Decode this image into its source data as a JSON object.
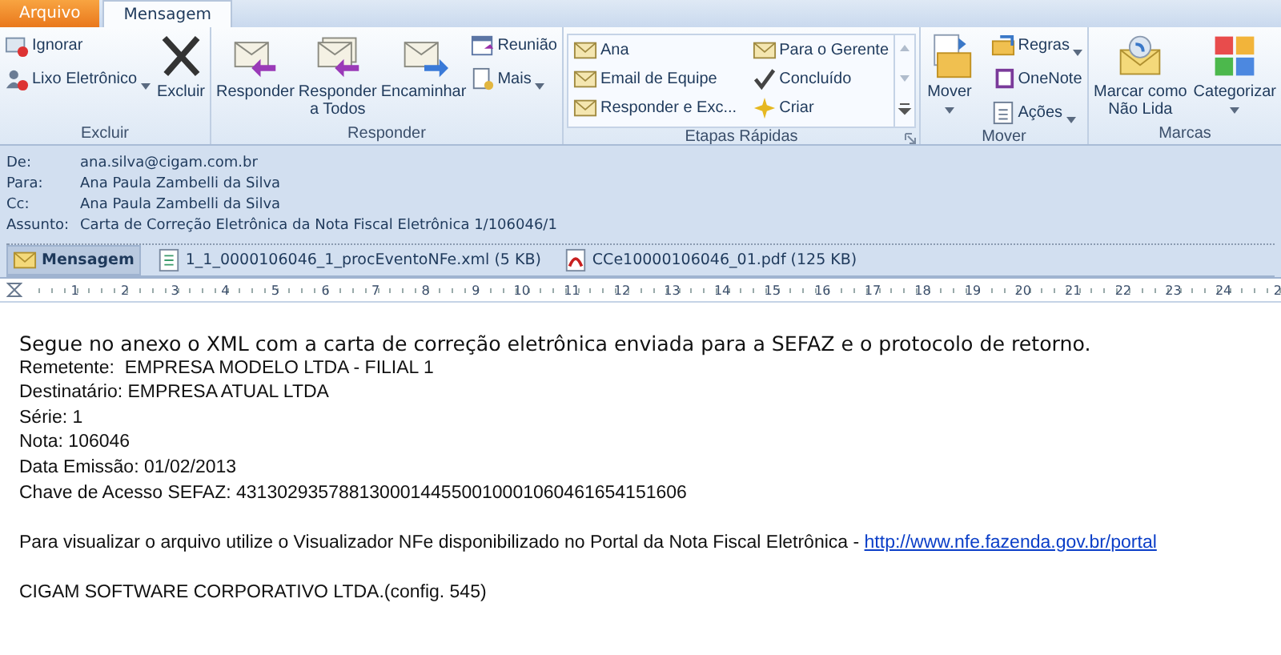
{
  "tabs": [
    {
      "label": "Arquivo",
      "kind": "file",
      "selected": false
    },
    {
      "label": "Mensagem",
      "kind": "tab",
      "selected": true
    }
  ],
  "ribbon": {
    "groups": [
      {
        "label": "Excluir",
        "kind": "buttons",
        "launcher": false,
        "buttons": [
          {
            "label": "Ignorar",
            "kind": "small",
            "dropdown": false
          },
          {
            "label": "Lixo Eletrônico",
            "kind": "small",
            "dropdown": true
          },
          {
            "label": "Excluir",
            "kind": "large",
            "dropdown": false
          }
        ]
      },
      {
        "label": "Responder",
        "kind": "buttons",
        "launcher": false,
        "buttons": [
          {
            "label": "Responder",
            "kind": "large",
            "dropdown": false
          },
          {
            "label": "Responder\na Todos",
            "kind": "large",
            "dropdown": false
          },
          {
            "label": "Encaminhar",
            "kind": "large",
            "dropdown": false
          },
          {
            "label": "Reunião",
            "kind": "small",
            "dropdown": false
          },
          {
            "label": "Mais",
            "kind": "small",
            "dropdown": true
          }
        ]
      },
      {
        "label": "Etapas Rápidas",
        "kind": "gallery",
        "launcher": true,
        "buttons": [
          {
            "label": "Ana"
          },
          {
            "label": "Email de Equipe"
          },
          {
            "label": "Responder e Exc..."
          },
          {
            "label": "Para o Gerente"
          },
          {
            "label": "Concluído"
          },
          {
            "label": "Criar"
          }
        ]
      },
      {
        "label": "Mover",
        "kind": "buttons",
        "launcher": false,
        "buttons": [
          {
            "label": "Mover",
            "kind": "large",
            "dropdown": true
          },
          {
            "label": "Regras",
            "kind": "small",
            "dropdown": true
          },
          {
            "label": "OneNote",
            "kind": "small",
            "dropdown": false
          },
          {
            "label": "Ações",
            "kind": "small",
            "dropdown": true
          }
        ]
      },
      {
        "label": "Marcas",
        "kind": "buttons",
        "launcher": false,
        "buttons": [
          {
            "label": "Marcar como\nNão Lida",
            "kind": "large",
            "dropdown": false
          },
          {
            "label": "Categorizar",
            "kind": "large",
            "dropdown": true
          }
        ]
      }
    ]
  },
  "header": [
    {
      "label": "De:",
      "value": "ana.silva@cigam.com.br"
    },
    {
      "label": "Para:",
      "value": "Ana Paula Zambelli da Silva"
    },
    {
      "label": "Cc:",
      "value": "Ana Paula Zambelli da Silva"
    },
    {
      "label": "Assunto:",
      "value": "Carta de Correção Eletrônica da Nota Fiscal Eletrônica 1/106046/1"
    }
  ],
  "attachments": [
    {
      "name": "Mensagem",
      "kind": "message",
      "selected": true
    },
    {
      "name": "1_1_0000106046_1_procEventoNFe.xml (5 KB)",
      "kind": "xml",
      "selected": false
    },
    {
      "name": "CCe10000106046_01.pdf (125 KB)",
      "kind": "pdf",
      "selected": false
    }
  ],
  "ruler": [
    "1",
    "2",
    "3",
    "4",
    "5",
    "6",
    "7",
    "8",
    "9",
    "10",
    "11",
    "12",
    "13",
    "14",
    "15",
    "16",
    "17",
    "18",
    "19",
    "20",
    "21",
    "22",
    "23",
    "24",
    "2"
  ],
  "body": [
    {
      "kind": "intro",
      "lines": [
        {
          "text": "Segue no anexo o XML com a carta de correção eletrônica enviada para a SEFAZ e o protocolo de retorno."
        }
      ]
    },
    {
      "kind": "plain",
      "lines": [
        {
          "text": "Remetente:  EMPRESA MODELO LTDA - FILIAL 1"
        },
        {
          "text": "Destinatário: EMPRESA ATUAL LTDA"
        },
        {
          "text": "Série: 1"
        },
        {
          "text": "Nota: 106046"
        },
        {
          "text": "Data Emissão: 01/02/2013"
        },
        {
          "text": "Chave de Acesso SEFAZ: 43130293578813000144550010001060461654151606"
        }
      ]
    },
    {
      "kind": "plain",
      "lines": [
        {
          "text": "Para visualizar o arquivo utilize o Visualizador NFe disponibilizado no Portal da Nota Fiscal Eletrônica - ",
          "link": "http://www.nfe.fazenda.gov.br/portal"
        }
      ]
    },
    {
      "kind": "plain",
      "lines": [
        {
          "text": "CIGAM SOFTWARE CORPORATIVO LTDA.(config. 545)"
        }
      ]
    }
  ]
}
